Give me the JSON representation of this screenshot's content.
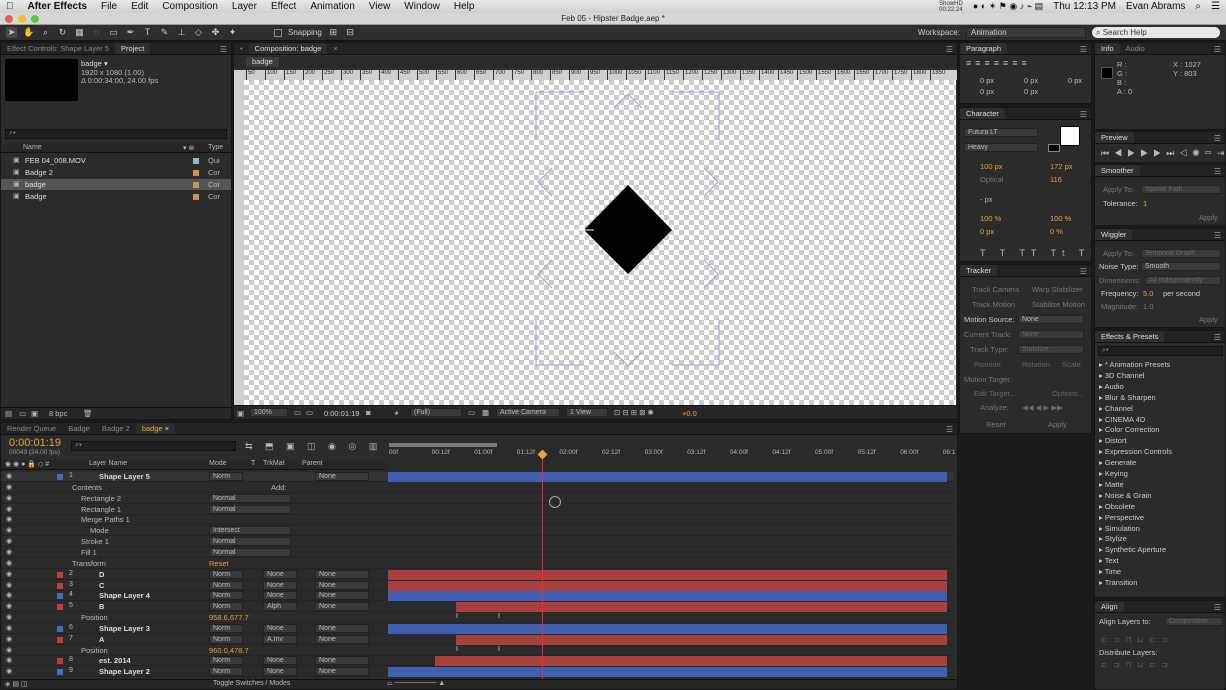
{
  "menubar": {
    "app_name": "After Effects",
    "items": [
      "File",
      "Edit",
      "Composition",
      "Layer",
      "Effect",
      "Animation",
      "View",
      "Window",
      "Help"
    ],
    "clock": "Thu 12:13 PM",
    "user": "Evan Abrams",
    "recording": "ShowHD\n00:22:24"
  },
  "window_title": "Feb 05 - Hipster Badge.aep *",
  "toolbar": {
    "snapping": "Snapping",
    "workspace_label": "Workspace:",
    "workspace_value": "Animation",
    "search_help": "Search Help"
  },
  "project": {
    "tabs": [
      "Effect Controls: Shape Layer 5",
      "Project"
    ],
    "active_tab": "Project",
    "preview_name": "badge ▾",
    "preview_info1": "1920 x 1080 (1.00)",
    "preview_info2": "Δ 0:00:34:00, 24.00 fps",
    "col_name": "Name",
    "col_type": "Type",
    "items": [
      {
        "name": "FEB 04_008.MOV",
        "type": "Qui",
        "color": "#8fb8c8"
      },
      {
        "name": "Badge 2",
        "type": "Cor",
        "color": "#c8945a"
      },
      {
        "name": "badge",
        "type": "Cor",
        "color": "#c8945a"
      },
      {
        "name": "Badge",
        "type": "Cor",
        "color": "#c8945a"
      }
    ],
    "bpc": "8 bpc"
  },
  "composition": {
    "tab": "Composition: badge",
    "flow_tab": "badge",
    "ruler": [
      "50",
      "100",
      "150",
      "200",
      "250",
      "300",
      "350",
      "400",
      "450",
      "500",
      "550",
      "600",
      "650",
      "700",
      "750",
      "800",
      "850",
      "900",
      "950",
      "1000",
      "1050",
      "1100",
      "1150",
      "1200",
      "1250",
      "1300",
      "1350",
      "1400",
      "1450",
      "1500",
      "1550",
      "1600",
      "1650",
      "1700",
      "1750",
      "1800",
      "1850"
    ],
    "zoom": "100%",
    "timecode": "0:00:01:19",
    "resolution": "(Full)",
    "camera": "Active Camera",
    "view": "1 View",
    "exposure": "+0.0"
  },
  "timeline": {
    "tabs": [
      "Render Queue",
      "Badge",
      "Badge 2",
      "badge"
    ],
    "active_tab": "badge",
    "current_time": "0:00:01:19",
    "frame_info": "00043 (24.00 fps)",
    "cols": {
      "layer_name": "Layer Name",
      "mode": "Mode",
      "t": "T",
      "trkmat": "TrkMat",
      "parent": "Parent"
    },
    "time_ticks": [
      "00f",
      "00:12f",
      "01:00f",
      "01:12f",
      "02:00f",
      "02:12f",
      "03:00f",
      "03:12f",
      "04:00f",
      "04:12f",
      "05:00f",
      "05:12f",
      "06:00f",
      "06:1"
    ],
    "toggle_label": "Toggle Switches / Modes",
    "rows": [
      {
        "num": "1",
        "name": "Shape Layer 5",
        "mode": "Norm",
        "parent": "None",
        "color": "#3b6fc4",
        "indent": 0,
        "bar": "blue"
      },
      {
        "name": "Contents",
        "indent": 1,
        "add": "Add:"
      },
      {
        "name": "Rectangle 2",
        "indent": 2,
        "mode": "Normal"
      },
      {
        "name": "Rectangle 1",
        "indent": 2,
        "mode": "Normal"
      },
      {
        "name": "Merge Paths 1",
        "indent": 2
      },
      {
        "name": "Mode",
        "indent": 3,
        "mode": "Intersect"
      },
      {
        "name": "Stroke 1",
        "indent": 2,
        "mode": "Normal"
      },
      {
        "name": "Fill 1",
        "indent": 2,
        "mode": "Normal"
      },
      {
        "name": "Transform",
        "indent": 1,
        "reset": "Reset"
      },
      {
        "num": "2",
        "name": "D",
        "mode": "Norm",
        "trk": "None",
        "parent": "None",
        "color": "#c43b3b",
        "bar": "red"
      },
      {
        "num": "3",
        "name": "C",
        "mode": "Norm",
        "trk": "None",
        "parent": "None",
        "color": "#c43b3b",
        "bar": "red"
      },
      {
        "num": "4",
        "name": "Shape Layer 4",
        "mode": "Norm",
        "trk": "None",
        "parent": "None",
        "color": "#3b6fc4",
        "bar": "blue"
      },
      {
        "num": "5",
        "name": "B",
        "mode": "Norm",
        "trk": "Alph",
        "parent": "None",
        "color": "#c43b3b",
        "bar": "red2"
      },
      {
        "name": "Position",
        "indent": 2,
        "value": "958.6,677.7"
      },
      {
        "num": "6",
        "name": "Shape Layer 3",
        "mode": "Norm",
        "trk": "None",
        "parent": "None",
        "color": "#3b6fc4",
        "bar": "blue"
      },
      {
        "num": "7",
        "name": "A",
        "mode": "Norm",
        "trk": "A.Inv",
        "parent": "None",
        "color": "#c43b3b",
        "bar": "red2"
      },
      {
        "name": "Position",
        "indent": 2,
        "value": "960.0,478.7"
      },
      {
        "num": "8",
        "name": "est. 2014",
        "mode": "Norm",
        "trk": "None",
        "parent": "None",
        "color": "#c43b3b",
        "bar": "red3"
      },
      {
        "num": "9",
        "name": "Shape Layer 2",
        "mode": "Norm",
        "trk": "None",
        "parent": "None",
        "color": "#3b6fc4",
        "bar": "blue2"
      }
    ]
  },
  "paragraph": {
    "title": "Paragraph",
    "vals": [
      "0 px",
      "0 px",
      "0 px",
      "0 px",
      "0 px"
    ]
  },
  "character": {
    "title": "Character",
    "font": "Futura LT",
    "style": "Heavy",
    "size": "100 px",
    "leading": "172 px",
    "kerning": "Optical",
    "tracking": "116",
    "stroke": "- px",
    "vscale": "100 %",
    "hscale": "100 %",
    "baseline": "0 px",
    "tsume": "0 %"
  },
  "tracker": {
    "title": "Tracker",
    "track_camera": "Track Camera",
    "warp": "Warp Stabilizer",
    "track_motion": "Track Motion",
    "stabilize": "Stabilize Motion",
    "motion_source": "Motion Source:",
    "motion_source_val": "None",
    "current_track": "Current Track:",
    "current_track_val": "None",
    "track_type": "Track Type:",
    "track_type_val": "Stabilize",
    "position": "Position",
    "rotation": "Rotation",
    "scale": "Scale",
    "motion_target": "Motion Target:",
    "edit_target": "Edit Target...",
    "options": "Options...",
    "analyze": "Analyze:",
    "reset": "Reset",
    "apply": "Apply"
  },
  "info": {
    "tabs": [
      "Info",
      "Audio"
    ],
    "r": "R :",
    "g": "G :",
    "b": "B :",
    "a": "A : 0",
    "x": "X : 1027",
    "y": "Y : 803"
  },
  "preview": {
    "title": "Preview"
  },
  "smoother": {
    "title": "Smoother",
    "apply_to": "Apply To:",
    "apply_to_val": "Spatial Path",
    "tolerance": "Tolerance:",
    "tolerance_val": "1",
    "apply": "Apply"
  },
  "wiggler": {
    "title": "Wiggler",
    "apply_to": "Apply To:",
    "apply_to_val": "Temporal Graph",
    "noise": "Noise Type:",
    "noise_val": "Smooth",
    "dimensions": "Dimensions:",
    "dimensions_val": "All Independently",
    "frequency": "Frequency:",
    "frequency_val": "5.0",
    "per_second": "per second",
    "magnitude": "Magnitude:",
    "magnitude_val": "1.0",
    "apply": "Apply"
  },
  "effects": {
    "title": "Effects & Presets",
    "items": [
      "* Animation Presets",
      "3D Channel",
      "Audio",
      "Blur & Sharpen",
      "Channel",
      "CINEMA 4D",
      "Color Correction",
      "Distort",
      "Expression Controls",
      "Generate",
      "Keying",
      "Matte",
      "Noise & Grain",
      "Obsolete",
      "Perspective",
      "Simulation",
      "Stylize",
      "Synthetic Aperture",
      "Text",
      "Time",
      "Transition"
    ]
  },
  "align": {
    "title": "Align",
    "align_to": "Align Layers to:",
    "align_to_val": "Composition",
    "distribute": "Distribute Layers:"
  }
}
